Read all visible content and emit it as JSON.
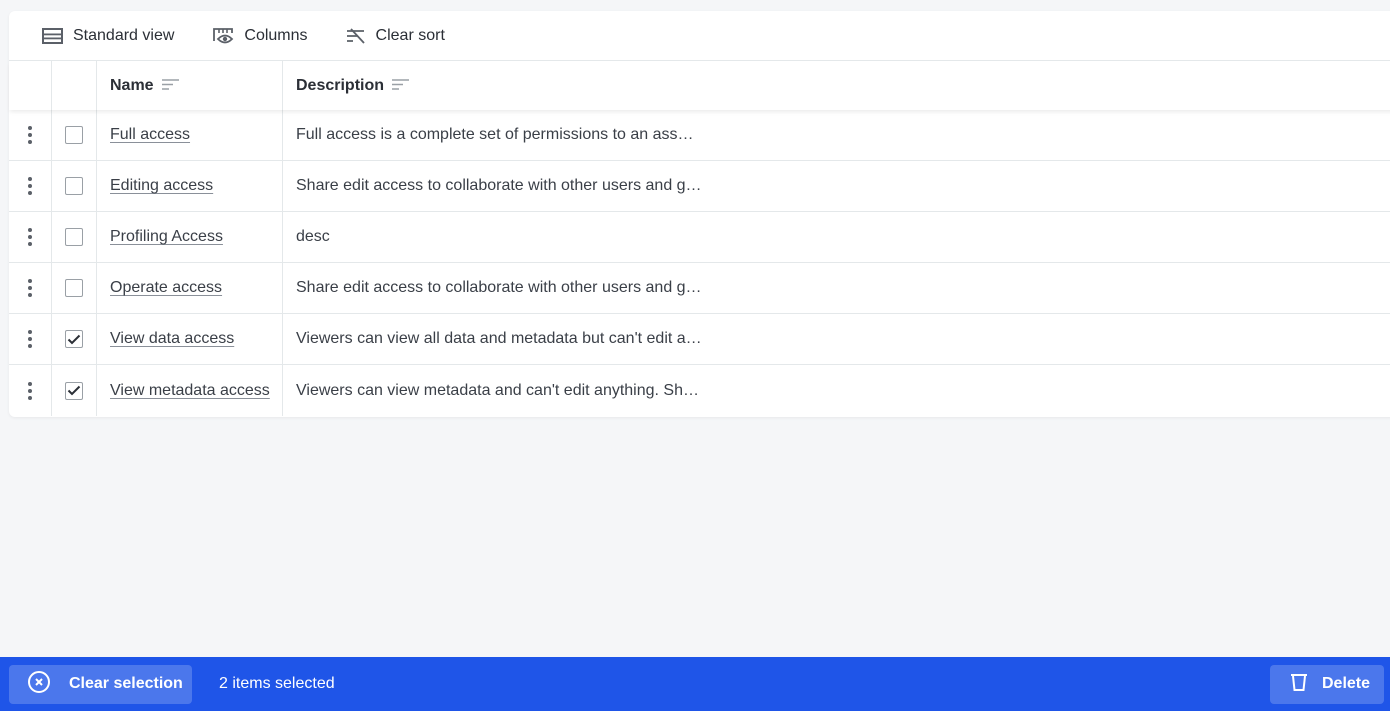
{
  "toolbar": {
    "standard_view_label": "Standard view",
    "columns_label": "Columns",
    "clear_sort_label": "Clear sort"
  },
  "table": {
    "columns": [
      {
        "label": "Name",
        "icon": "sort-lines-icon"
      },
      {
        "label": "Description",
        "icon": "sort-lines-icon"
      }
    ],
    "rows": [
      {
        "name": "Full access",
        "description": "Full access is a complete set of permissions to an ass…",
        "checked": false
      },
      {
        "name": "Editing access",
        "description": "Share edit access to collaborate with other users and g…",
        "checked": false
      },
      {
        "name": "Profiling Access",
        "description": "desc",
        "checked": false
      },
      {
        "name": "Operate access",
        "description": "Share edit access to collaborate with other users and g…",
        "checked": false
      },
      {
        "name": "View data access",
        "description": "Viewers can view all data and metadata but can't edit a…",
        "checked": true
      },
      {
        "name": "View metadata access",
        "description": "Viewers can view metadata and can't edit anything. Sh…",
        "checked": true
      }
    ]
  },
  "footer": {
    "clear_selection_label": "Clear selection",
    "selected_count_text": "2 items selected",
    "delete_label": "Delete",
    "bar_color": "#1f55e8"
  }
}
